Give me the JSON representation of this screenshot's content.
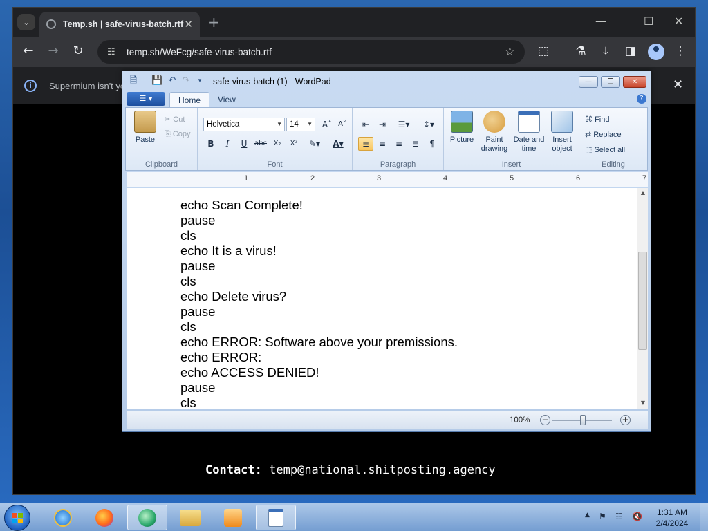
{
  "browser": {
    "tab_title": "Temp.sh | safe-virus-batch.rtf",
    "url": "temp.sh/WeFcg/safe-virus-batch.rtf",
    "infobar_text": "Supermium isn't yo",
    "page_contact_label": "Contact:",
    "page_contact_email": "temp@national.shitposting.agency"
  },
  "wordpad": {
    "title": "safe-virus-batch (1) - WordPad",
    "tabs": [
      "Home",
      "View"
    ],
    "clipboard": {
      "paste": "Paste",
      "cut": "Cut",
      "copy": "Copy",
      "label": "Clipboard"
    },
    "font": {
      "family": "Helvetica",
      "size": "14",
      "label": "Font"
    },
    "paragraph": {
      "label": "Paragraph"
    },
    "insert": {
      "picture": "Picture",
      "paint": "Paint drawing",
      "datetime": "Date and time",
      "object": "Insert object",
      "label": "Insert"
    },
    "editing": {
      "find": "Find",
      "replace": "Replace",
      "select_all": "Select all",
      "label": "Editing"
    },
    "ruler_numbers": [
      "1",
      "2",
      "3",
      "4",
      "5",
      "6",
      "7"
    ],
    "document_lines": [
      "echo Scan Complete!",
      "pause",
      "cls",
      "echo It is a virus!",
      "pause",
      "cls",
      "echo Delete virus?",
      "pause",
      "cls",
      "echo ERROR: Software above your premissions.",
      "echo ERROR:",
      "echo ACCESS DENIED!",
      "pause",
      "cls"
    ],
    "zoom": "100%"
  },
  "taskbar": {
    "time": "1:31 AM",
    "date": "2/4/2024"
  },
  "colors": {
    "chrome_dark": "#202124",
    "chrome_toolbar": "#35363a",
    "ribbon_blue": "#c9dbf2",
    "taskbar_blue": "#9cbde3"
  }
}
